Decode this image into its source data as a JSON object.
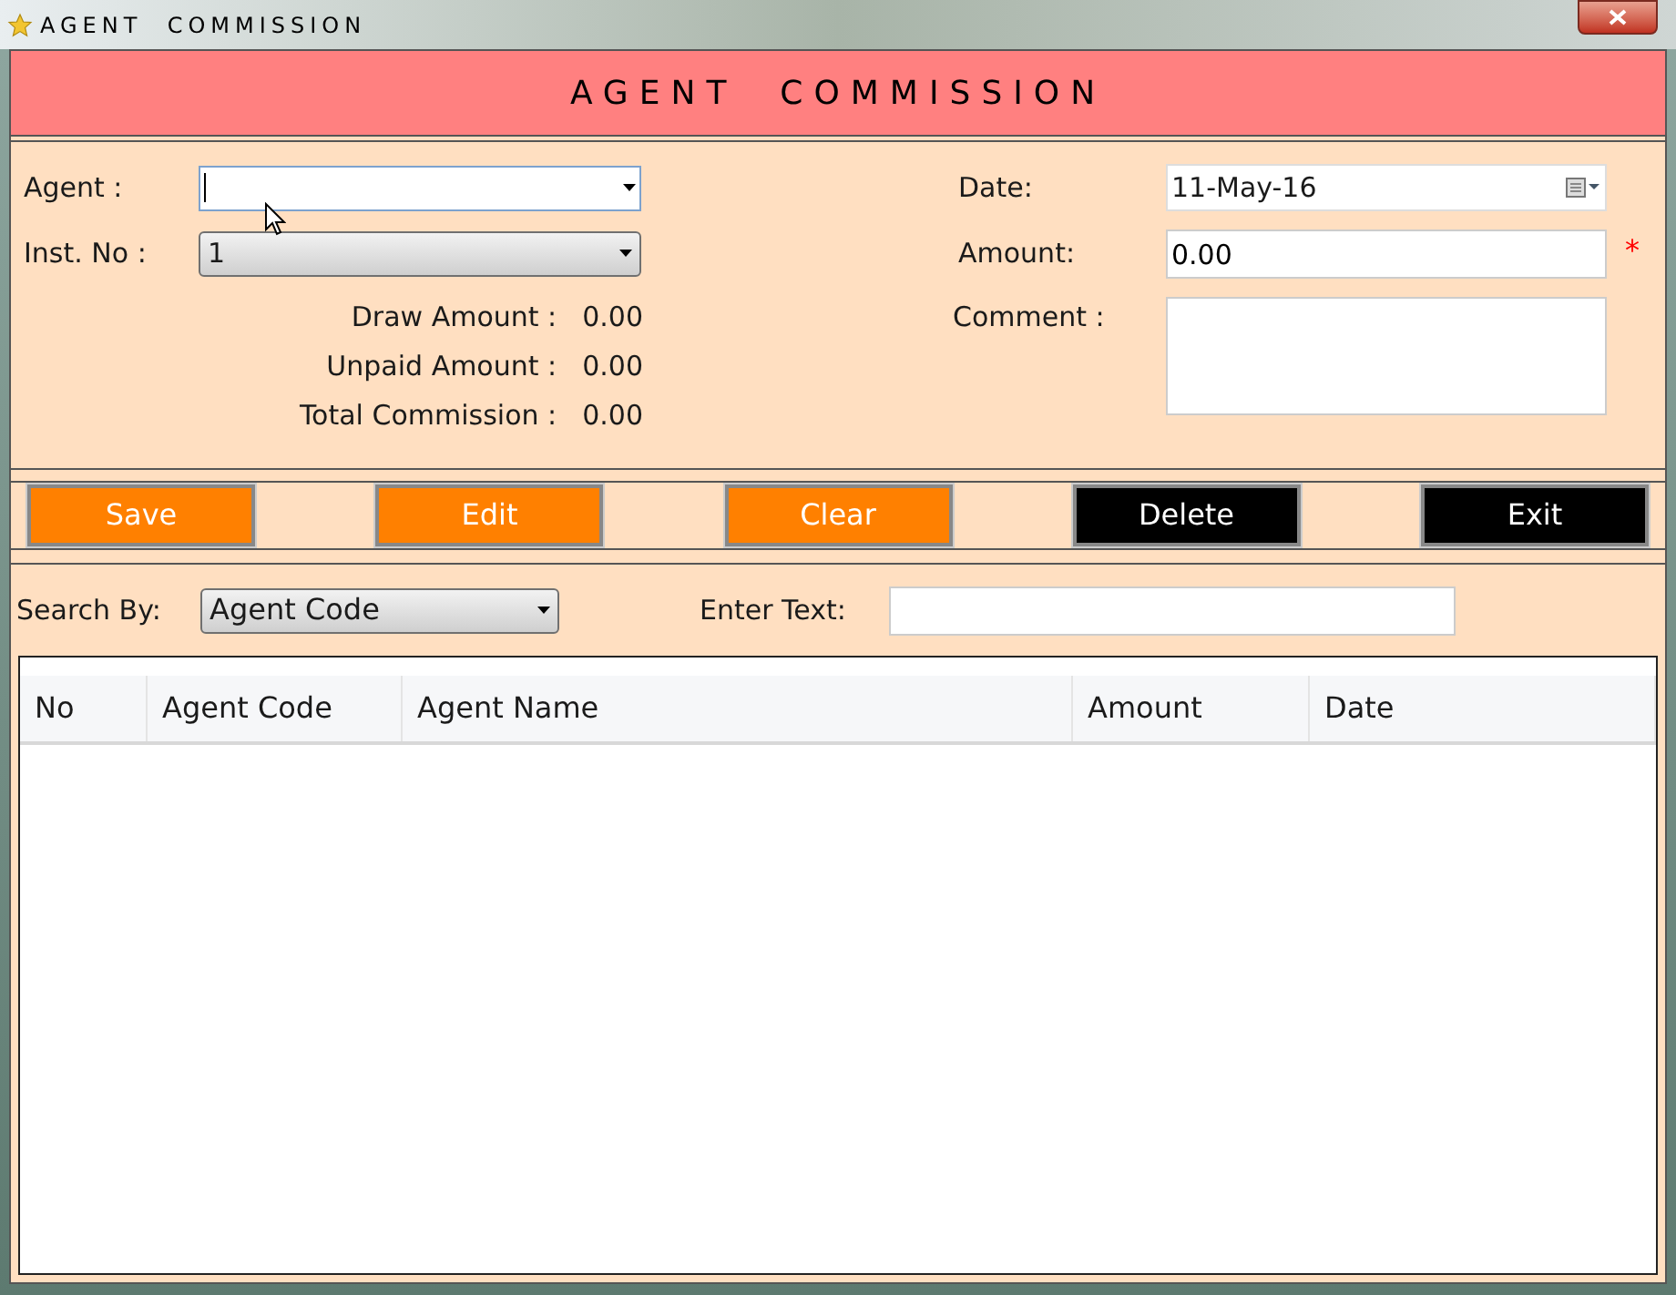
{
  "window": {
    "title": "AGENT  COMMISSION"
  },
  "header": {
    "title": "AGENT  COMMISSION"
  },
  "form": {
    "agent": {
      "label": "Agent :"
    },
    "inst_no": {
      "label": "Inst. No :",
      "value": "1"
    },
    "summary": [
      {
        "label": "Draw Amount :",
        "value": "0.00"
      },
      {
        "label": "Unpaid Amount :",
        "value": "0.00"
      },
      {
        "label": "Total Commission :",
        "value": "0.00"
      }
    ],
    "date": {
      "label": "Date:",
      "value": "11-May-16"
    },
    "amount": {
      "label": "Amount:",
      "value": "0.00",
      "required_mark": "*"
    },
    "comment": {
      "label": "Comment :"
    }
  },
  "buttons": [
    {
      "label": "Save",
      "color": "#ff8000"
    },
    {
      "label": "Edit",
      "color": "#ff8000"
    },
    {
      "label": "Clear",
      "color": "#ff8000"
    },
    {
      "label": "Delete",
      "color": "#000000"
    },
    {
      "label": "Exit",
      "color": "#000000"
    }
  ],
  "search": {
    "by_label": "Search By:",
    "by_value": "Agent Code",
    "text_label": "Enter Text:"
  },
  "table": {
    "columns": [
      "No",
      "Agent Code",
      "Agent Name",
      "Amount",
      "Date"
    ]
  }
}
